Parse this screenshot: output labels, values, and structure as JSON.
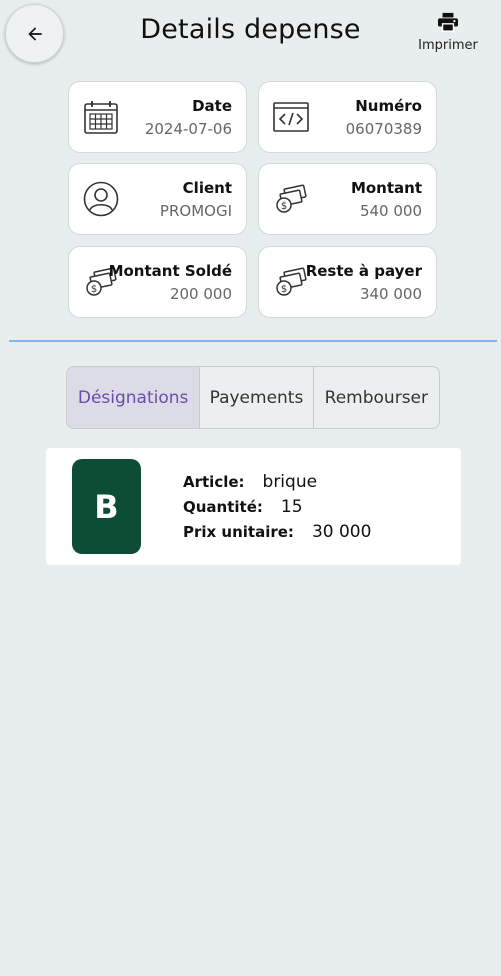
{
  "header": {
    "title": "Details depense",
    "print_label": "Imprimer",
    "back_icon": "arrow-left-icon",
    "print_icon": "printer-icon"
  },
  "cards": {
    "date": {
      "title": "Date",
      "value": "2024-07-06",
      "icon": "calendar-icon"
    },
    "numero": {
      "title": "Numéro",
      "value": "06070389",
      "icon": "code-icon"
    },
    "client": {
      "title": "Client",
      "value": "PROMOGI",
      "icon": "user-icon"
    },
    "montant": {
      "title": "Montant",
      "value": "540 000",
      "icon": "money-icon"
    },
    "montant_solde": {
      "title": "Montant Soldé",
      "value": "200 000",
      "icon": "money-icon"
    },
    "reste": {
      "title": "Reste à payer",
      "value": "340 000",
      "icon": "money-icon"
    }
  },
  "tabs": [
    {
      "label": "Désignations",
      "active": true
    },
    {
      "label": "Payements",
      "active": false
    },
    {
      "label": "Rembourser",
      "active": false
    }
  ],
  "article": {
    "initial": "B",
    "avatar_color": "#0d4d35",
    "article_label": "Article:",
    "article_value": "brique",
    "quantite_label": "Quantité:",
    "quantite_value": "15",
    "prix_label": "Prix unitaire:",
    "prix_value": "30 000"
  },
  "colors": {
    "accent": "#6b4cab",
    "divider": "#7fb8ec",
    "background": "#e8eeee"
  }
}
